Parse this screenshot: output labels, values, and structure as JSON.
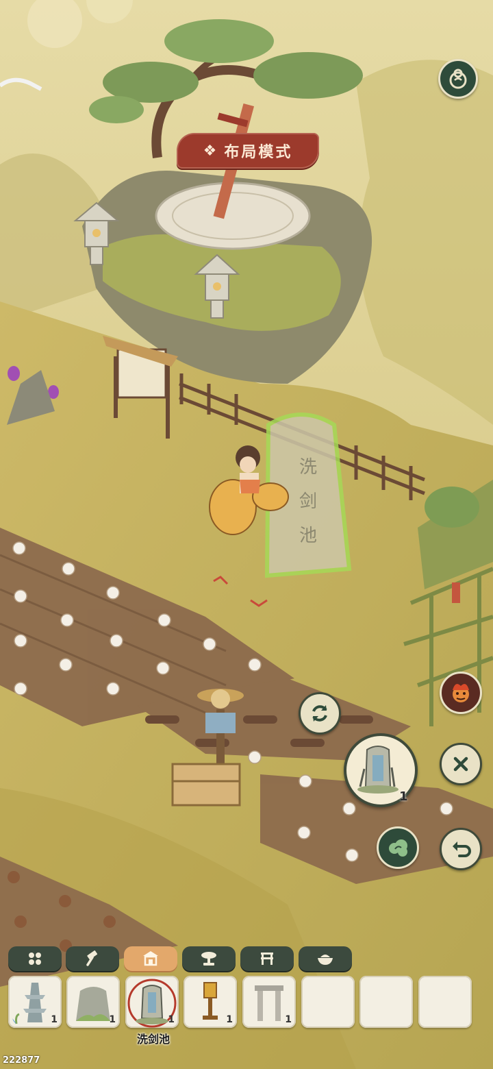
{
  "mode_banner": {
    "label": "布局模式",
    "icon": "diamond-ornament-icon"
  },
  "top_right_button": {
    "icon": "gourd-swirl-icon"
  },
  "stele_inscription": "洗剑池",
  "world_actions": {
    "rotate": {
      "icon": "rotate-arrows-icon"
    },
    "cancel": {
      "icon": "close-x-icon"
    },
    "store": {
      "icon": "cloud-swirl-icon"
    },
    "undo": {
      "icon": "undo-arrow-icon"
    },
    "npc_portrait": {
      "icon": "fire-demon-portrait"
    },
    "selected_count": "1"
  },
  "category_tabs": [
    {
      "icon": "grid-four-icon",
      "active": false
    },
    {
      "icon": "hammer-icon",
      "active": false
    },
    {
      "icon": "shrine-icon",
      "active": true
    },
    {
      "icon": "bonsai-tree-icon",
      "active": false
    },
    {
      "icon": "screen-fence-icon",
      "active": false
    },
    {
      "icon": "rice-bowl-icon",
      "active": false
    }
  ],
  "inventory": {
    "slots": [
      {
        "item": "stone-pagoda",
        "count": "1"
      },
      {
        "item": "mossy-rock",
        "count": "1"
      },
      {
        "item": "sword-stele",
        "count": "1",
        "selected": true
      },
      {
        "item": "golden-lantern",
        "count": "1"
      },
      {
        "item": "stone-archway",
        "count": "1"
      },
      {
        "item": "",
        "count": ""
      },
      {
        "item": "",
        "count": ""
      },
      {
        "item": "",
        "count": ""
      }
    ],
    "selected_label": "洗剑池"
  },
  "build_id": "222877",
  "colors": {
    "accent_red": "#9c3a2c",
    "tab_dark": "#3c4a3e",
    "tab_active": "#e3a86b",
    "slot_bg": "#f3efe3"
  }
}
